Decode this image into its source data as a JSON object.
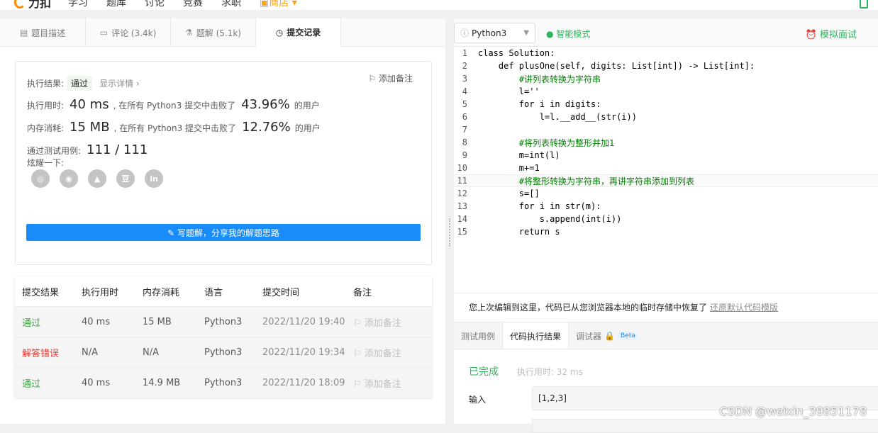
{
  "nav": {
    "logo_text": "力扣",
    "items": [
      "学习",
      "题库",
      "讨论",
      "竞赛",
      "求职"
    ],
    "shop": "商店"
  },
  "left_tabs": [
    {
      "label": "题目描述",
      "icon": "description-icon"
    },
    {
      "label": "评论 (3.4k)",
      "icon": "comment-icon"
    },
    {
      "label": "题解 (5.1k)",
      "icon": "flask-icon"
    },
    {
      "label": "提交记录",
      "icon": "clock-icon"
    }
  ],
  "result": {
    "exec_result_label": "执行结果:",
    "status": "通过",
    "show_detail": "显示详情 ›",
    "add_note": "添加备注",
    "time_label": "执行用时:",
    "time_value": "40 ms",
    "time_mid": ", 在所有 Python3 提交中击败了",
    "time_pct": "43.96%",
    "time_suffix": "的用户",
    "mem_label": "内存消耗:",
    "mem_value": "15 MB",
    "mem_mid": ", 在所有 Python3 提交中击败了",
    "mem_pct": "12.76%",
    "mem_suffix": "的用户",
    "cases_label": "通过测试用例:",
    "cases_value": "111 / 111",
    "share_label": "炫耀一下:",
    "share_icons": [
      "wechat-icon",
      "weibo-icon",
      "qq-icon",
      "douban-icon",
      "linkedin-icon"
    ],
    "write_button": "✎ 写题解，分享我的解题思路"
  },
  "submissions": {
    "headers": [
      "提交结果",
      "执行用时",
      "内存消耗",
      "语言",
      "提交时间",
      "备注"
    ],
    "rows": [
      {
        "status": "通过",
        "time": "40 ms",
        "memory": "15 MB",
        "lang": "Python3",
        "submitted": "2022/11/20 19:40",
        "note": "添加备注",
        "kind": "pass"
      },
      {
        "status": "解答错误",
        "time": "N/A",
        "memory": "N/A",
        "lang": "Python3",
        "submitted": "2022/11/20 19:34",
        "note": "添加备注",
        "kind": "fail"
      },
      {
        "status": "通过",
        "time": "40 ms",
        "memory": "14.9 MB",
        "lang": "Python3",
        "submitted": "2022/11/20 18:09",
        "note": "添加备注",
        "kind": "pass"
      }
    ]
  },
  "editor": {
    "language": "Python3",
    "smart_mode": "智能模式",
    "mock_interview": "模拟面试",
    "lines": [
      "class Solution:",
      "    def plusOne(self, digits: List[int]) -> List[int]:",
      "        #讲列表转换为字符串",
      "        l=''",
      "        for i in digits:",
      "            l=l.__add__(str(i))",
      "",
      "        #将列表转换为整形并加1",
      "        m=int(l)",
      "        m+=1",
      "        #将整形转换为字符串，再讲字符串添加到列表",
      "        s=[]",
      "        for i in str(m):",
      "            s.append(int(i))",
      "        return s"
    ],
    "highlight_line": 11
  },
  "restore": {
    "text": "您上次编辑到这里，代码已从您浏览器本地的临时存储中恢复了",
    "link": "还原默认代码模版"
  },
  "bottom_tabs": [
    "测试用例",
    "代码执行结果",
    "调试器"
  ],
  "beta": "Beta",
  "run": {
    "status": "已完成",
    "exec_time": "执行用时: 32 ms",
    "input_label": "输入",
    "input_value": "[1,2,3]"
  },
  "watermark": "CSDN @weixin_39851178",
  "colors": {
    "accent_green": "#2db55d",
    "brand_orange": "#ffa116",
    "button_blue": "#1a8cfa",
    "fail_red": "#e53935"
  }
}
